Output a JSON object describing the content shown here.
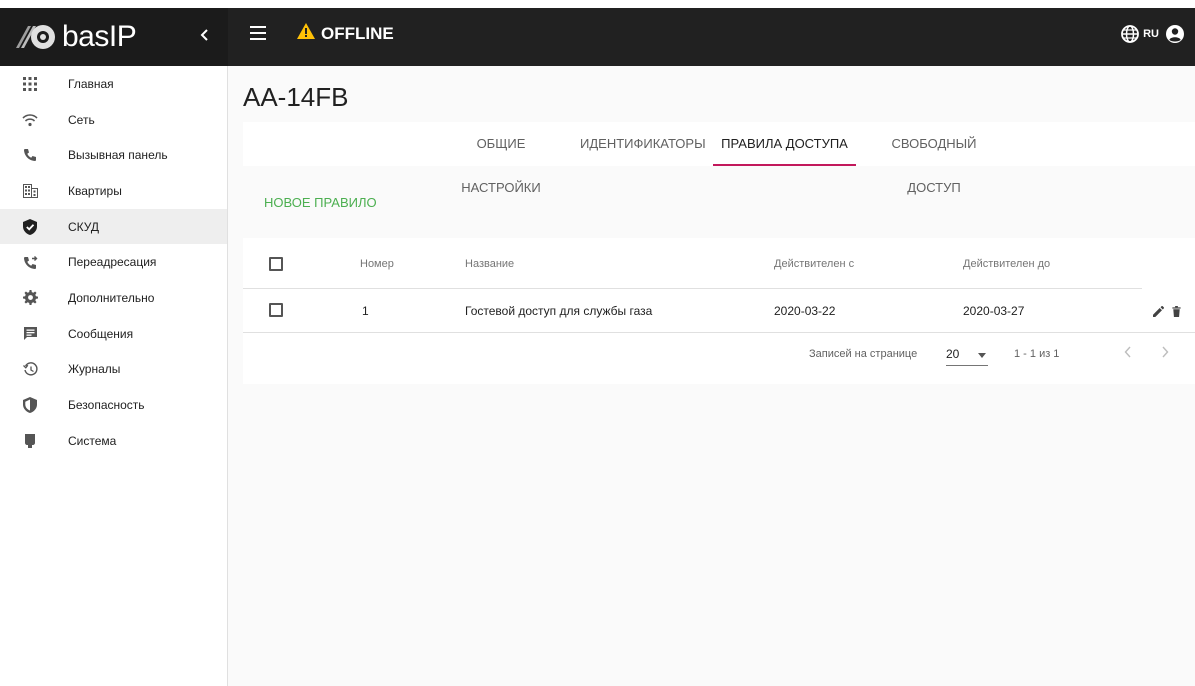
{
  "header": {
    "logo_text": "basIP",
    "status": "OFFLINE",
    "language": "RU",
    "colors": {
      "bar": "#212121",
      "warning": "#ffc107"
    }
  },
  "sidebar": {
    "items": [
      {
        "label": "Главная",
        "icon": "apps-grid-icon"
      },
      {
        "label": "Сеть",
        "icon": "wifi-icon"
      },
      {
        "label": "Вызывная панель",
        "icon": "phone-icon"
      },
      {
        "label": "Квартиры",
        "icon": "building-icon"
      },
      {
        "label": "СКУД",
        "icon": "shield-check-icon",
        "active": true
      },
      {
        "label": "Переадресация",
        "icon": "phone-forward-icon"
      },
      {
        "label": "Дополнительно",
        "icon": "gear-icon"
      },
      {
        "label": "Сообщения",
        "icon": "message-icon"
      },
      {
        "label": "Журналы",
        "icon": "history-icon"
      },
      {
        "label": "Безопасность",
        "icon": "security-shield-icon"
      },
      {
        "label": "Система",
        "icon": "device-icon"
      }
    ]
  },
  "main": {
    "title": "AA-14FB",
    "tabs": [
      {
        "label": "ОБЩИЕ НАСТРОЙКИ"
      },
      {
        "label": "ИДЕНТИФИКАТОРЫ"
      },
      {
        "label": "ПРАВИЛА ДОСТУПА",
        "active": true
      },
      {
        "label": "СВОБОДНЫЙ ДОСТУП"
      }
    ],
    "new_rule_label": "НОВОЕ ПРАВИЛО",
    "accent_color": "#c2185b",
    "action_color": "#4caf50",
    "table": {
      "columns": [
        "Номер",
        "Название",
        "Действителен с",
        "Действителен до"
      ],
      "rows": [
        {
          "number": "1",
          "name": "Гостевой доступ для службы газа",
          "from": "2020-03-22",
          "to": "2020-03-27"
        }
      ],
      "footer": {
        "rows_per_page_label": "Записей на странице",
        "rows_per_page_value": "20",
        "range": "1 - 1 из 1"
      }
    }
  }
}
